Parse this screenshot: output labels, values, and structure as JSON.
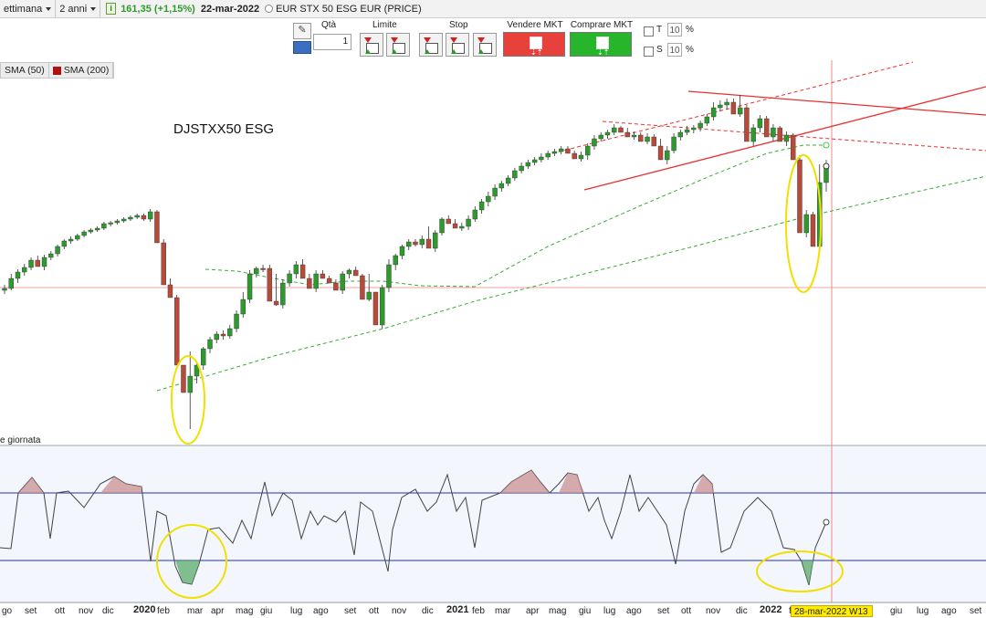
{
  "topbar": {
    "period_label": "ettimana",
    "range_label": "2 anni",
    "last_price": "161,35",
    "change": "(+1,15%)",
    "date": "22-mar-2022",
    "instrument": "EUR STX 50 ESG EUR (PRICE)"
  },
  "orderbar": {
    "qty_label": "Qtà",
    "qty_value": "1",
    "limit_label": "Limite",
    "stop_label": "Stop",
    "sell_label": "Vendere MKT",
    "buy_label": "Comprare MKT",
    "t_label": "T",
    "s_label": "S",
    "t_value": "10",
    "s_value": "10",
    "percent": "%",
    "sell_color": "#e8413b",
    "buy_color": "#27b52b"
  },
  "legend": {
    "sma50": "SMA (50)",
    "sma200": "SMA (200)",
    "sma200_color": "#b01010"
  },
  "chart_title": "DJSTXX50 ESG",
  "rsi_label": "e giornata",
  "x_axis": {
    "labels": [
      "go",
      "set",
      "ott",
      "nov",
      "dic",
      "2020",
      "feb",
      "mar",
      "apr",
      "mag",
      "giu",
      "lug",
      "ago",
      "set",
      "ott",
      "nov",
      "dic",
      "2021",
      "feb",
      "mar",
      "apr",
      "mag",
      "giu",
      "lug",
      "ago",
      "set",
      "ott",
      "nov",
      "dic",
      "2022",
      "feb",
      "giu",
      "lug",
      "ago",
      "set"
    ],
    "bold": [
      "2020",
      "2021",
      "2022"
    ],
    "crosshair_label": "28-mar-2022 W13"
  },
  "chart_data": {
    "type": "candlestick",
    "title": "DJSTXX50 ESG",
    "period": "weekly",
    "range": "2 anni",
    "categories_start": "2019-08",
    "ohlc": [
      [
        318,
        316,
        322,
        312
      ],
      [
        316,
        305,
        318,
        300
      ],
      [
        305,
        298,
        310,
        295
      ],
      [
        298,
        293,
        302,
        289
      ],
      [
        293,
        285,
        296,
        282
      ],
      [
        285,
        292,
        288,
        280
      ],
      [
        292,
        282,
        296,
        279
      ],
      [
        282,
        278,
        285,
        275
      ],
      [
        278,
        270,
        281,
        268
      ],
      [
        270,
        264,
        273,
        262
      ],
      [
        264,
        262,
        267,
        259
      ],
      [
        262,
        258,
        264,
        256
      ],
      [
        258,
        254,
        260,
        252
      ],
      [
        254,
        252,
        256,
        250
      ],
      [
        252,
        250,
        254,
        248
      ],
      [
        250,
        245,
        252,
        243
      ],
      [
        245,
        244,
        248,
        242
      ],
      [
        244,
        242,
        246,
        240
      ],
      [
        242,
        240,
        244,
        238
      ],
      [
        240,
        238,
        242,
        236
      ],
      [
        238,
        236,
        240,
        234
      ],
      [
        236,
        240,
        242,
        234
      ],
      [
        240,
        232,
        243,
        229
      ],
      [
        232,
        266,
        236,
        230
      ],
      [
        266,
        312,
        268,
        262
      ],
      [
        312,
        326,
        318,
        305
      ],
      [
        326,
        400,
        333,
        323
      ],
      [
        400,
        430,
        410,
        425
      ],
      [
        430,
        412,
        470,
        385
      ],
      [
        412,
        400,
        420,
        396
      ],
      [
        400,
        382,
        405,
        380
      ],
      [
        382,
        372,
        387,
        369
      ],
      [
        372,
        366,
        376,
        363
      ],
      [
        366,
        368,
        372,
        362
      ],
      [
        368,
        360,
        371,
        356
      ],
      [
        360,
        344,
        364,
        340
      ],
      [
        344,
        328,
        348,
        320
      ],
      [
        328,
        300,
        332,
        296
      ],
      [
        300,
        294,
        304,
        292
      ],
      [
        294,
        294,
        298,
        290
      ],
      [
        294,
        330,
        300,
        290
      ],
      [
        330,
        334,
        335,
        300
      ],
      [
        334,
        310,
        338,
        306
      ],
      [
        310,
        300,
        314,
        296
      ],
      [
        300,
        290,
        305,
        286
      ],
      [
        290,
        305,
        296,
        284
      ],
      [
        305,
        316,
        310,
        300
      ],
      [
        316,
        300,
        320,
        296
      ],
      [
        300,
        305,
        303,
        296
      ],
      [
        305,
        310,
        309,
        302
      ],
      [
        310,
        318,
        314,
        306
      ],
      [
        318,
        300,
        322,
        297
      ],
      [
        300,
        296,
        305,
        294
      ],
      [
        296,
        302,
        300,
        292
      ],
      [
        302,
        328,
        308,
        300
      ],
      [
        328,
        320,
        330,
        300
      ],
      [
        320,
        356,
        326,
        320
      ],
      [
        356,
        315,
        360,
        312
      ],
      [
        315,
        290,
        320,
        284
      ],
      [
        290,
        280,
        296,
        278
      ],
      [
        280,
        270,
        284,
        268
      ],
      [
        270,
        265,
        274,
        262
      ],
      [
        265,
        268,
        270,
        262
      ],
      [
        268,
        262,
        272,
        258
      ],
      [
        262,
        272,
        266,
        248
      ],
      [
        272,
        255,
        276,
        252
      ],
      [
        255,
        240,
        258,
        238
      ],
      [
        240,
        245,
        244,
        236
      ],
      [
        245,
        250,
        249,
        240
      ],
      [
        250,
        248,
        253,
        244
      ],
      [
        248,
        240,
        252,
        236
      ],
      [
        240,
        230,
        243,
        226
      ],
      [
        230,
        221,
        234,
        218
      ],
      [
        221,
        215,
        226,
        210
      ],
      [
        215,
        206,
        219,
        202
      ],
      [
        206,
        201,
        210,
        198
      ],
      [
        201,
        195,
        204,
        192
      ],
      [
        195,
        187,
        198,
        184
      ],
      [
        187,
        182,
        190,
        178
      ],
      [
        182,
        178,
        185,
        175
      ],
      [
        178,
        175,
        181,
        172
      ],
      [
        175,
        172,
        178,
        168
      ],
      [
        172,
        168,
        175,
        165
      ],
      [
        168,
        166,
        171,
        163
      ],
      [
        166,
        163,
        169,
        160
      ],
      [
        163,
        168,
        166,
        160
      ],
      [
        168,
        174,
        172,
        165
      ],
      [
        174,
        170,
        177,
        166
      ],
      [
        170,
        160,
        175,
        157
      ],
      [
        160,
        152,
        164,
        148
      ],
      [
        152,
        148,
        155,
        145
      ],
      [
        148,
        145,
        152,
        142
      ],
      [
        145,
        140,
        148,
        136
      ],
      [
        140,
        145,
        143,
        138
      ],
      [
        145,
        150,
        148,
        140
      ],
      [
        150,
        148,
        153,
        144
      ],
      [
        148,
        155,
        152,
        145
      ],
      [
        155,
        150,
        158,
        146
      ],
      [
        150,
        160,
        154,
        147
      ],
      [
        160,
        175,
        165,
        152
      ],
      [
        175,
        165,
        180,
        160
      ],
      [
        165,
        150,
        168,
        146
      ],
      [
        150,
        145,
        154,
        142
      ],
      [
        145,
        142,
        148,
        138
      ],
      [
        142,
        140,
        146,
        137
      ],
      [
        140,
        135,
        144,
        132
      ],
      [
        135,
        128,
        138,
        125
      ],
      [
        128,
        118,
        132,
        112
      ],
      [
        118,
        115,
        122,
        110
      ],
      [
        115,
        112,
        120,
        108
      ],
      [
        112,
        125,
        116,
        108
      ],
      [
        125,
        118,
        128,
        104
      ],
      [
        118,
        155,
        122,
        115
      ],
      [
        155,
        140,
        160,
        136
      ],
      [
        140,
        130,
        145,
        126
      ],
      [
        130,
        150,
        135,
        127
      ],
      [
        150,
        140,
        155,
        136
      ],
      [
        140,
        155,
        145,
        138
      ],
      [
        155,
        148,
        160,
        144
      ],
      [
        148,
        175,
        152,
        146
      ],
      [
        175,
        255,
        180,
        170
      ],
      [
        255,
        235,
        260,
        230
      ],
      [
        235,
        270,
        245,
        232
      ],
      [
        270,
        200,
        275,
        180
      ],
      [
        200,
        180,
        210,
        175
      ]
    ],
    "sma_short": "green dashed",
    "sma_long": "green dashed",
    "rsi_panel": true,
    "annotations": [
      "yellow ellipse mar-2020",
      "yellow ellipse feb-2022"
    ]
  }
}
